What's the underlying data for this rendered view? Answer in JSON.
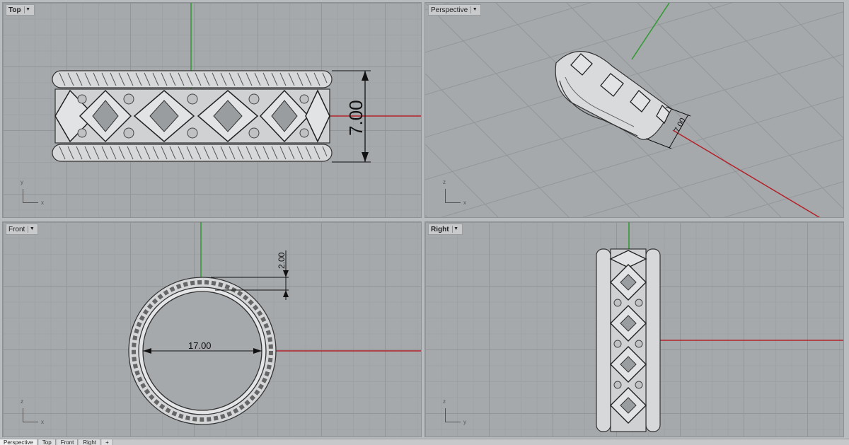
{
  "viewports": {
    "top": {
      "title": "Top",
      "dimension": "7.00",
      "axis_v": "y",
      "axis_h": "x"
    },
    "perspective": {
      "title": "Perspective",
      "dimension": "7.00",
      "axis_v": "z",
      "axis_h": "x"
    },
    "front": {
      "title": "Front",
      "dimension_width": "2.00",
      "dimension_diameter": "17.00",
      "axis_v": "z",
      "axis_h": "x"
    },
    "right": {
      "title": "Right",
      "axis_v": "z",
      "axis_h": "y"
    }
  },
  "tabs": [
    {
      "label": "Perspective"
    },
    {
      "label": "Top"
    },
    {
      "label": "Front"
    },
    {
      "label": "Right"
    },
    {
      "label": "+"
    }
  ],
  "colors": {
    "grid_bg": "#a6a9ac",
    "x_axis": "#b2222a",
    "y_axis": "#2e9a2e",
    "ring_metal": "#d6d8da"
  }
}
